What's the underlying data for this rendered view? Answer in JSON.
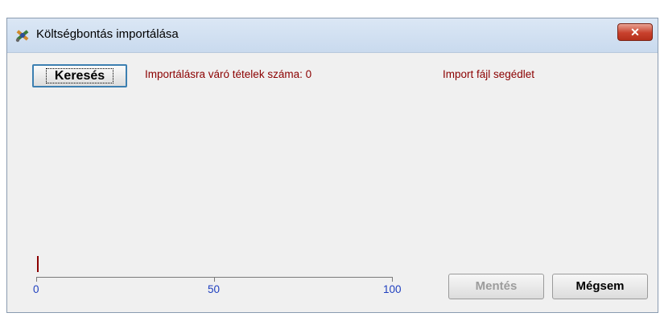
{
  "window": {
    "title": "Költségbontás importálása",
    "close_label": "✕"
  },
  "toolbar": {
    "search_label": "Keresés",
    "pending_items_label": "Importálásra váró tételek száma: 0",
    "help_link_label": "Import fájl segédlet"
  },
  "progress": {
    "value": 0,
    "scale": {
      "min": "0",
      "mid": "50",
      "max": "100"
    }
  },
  "footer": {
    "save_label": "Mentés",
    "save_enabled": false,
    "cancel_label": "Mégsem"
  },
  "colors": {
    "label_text": "#8b0000",
    "scale_text": "#1f3fbf",
    "close_button": "#c8412d"
  }
}
